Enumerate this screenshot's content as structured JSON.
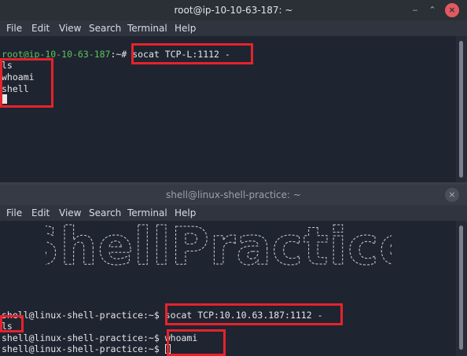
{
  "top_window": {
    "title": "root@ip-10-10-63-187: ~",
    "menu": [
      "File",
      "Edit",
      "View",
      "Search",
      "Terminal",
      "Help"
    ],
    "prompt_user": "root@ip-10-10-63-187",
    "prompt_path": ":~#",
    "command": " socat TCP-L:1112 -",
    "output": [
      "ls",
      "whoami",
      "shell"
    ],
    "controls": {
      "minimize": "‒",
      "maximize": "⌃",
      "close": "×"
    }
  },
  "bottom_window": {
    "title": "shell@linux-shell-practice: ~",
    "menu": [
      "File",
      "Edit",
      "View",
      "Search",
      "Terminal",
      "Help"
    ],
    "banner_text": "ShellPractice",
    "prompt": "shell@linux-shell-practice:~$",
    "lines": [
      {
        "prompt": "shell@linux-shell-practice:~$",
        "command": " socat TCP:10.10.63.187:1112 -"
      },
      {
        "prompt": "",
        "command": "ls"
      },
      {
        "prompt": "shell@linux-shell-practice:~$",
        "command": " whoami"
      },
      {
        "prompt": "shell@linux-shell-practice:~$",
        "command": " "
      }
    ],
    "controls": {
      "close": "×"
    }
  },
  "colors": {
    "titlebar_bg": "#2b2f36",
    "terminal_bg": "#1f2431",
    "prompt_green": "#5ec25b",
    "highlight_red": "#e6222c",
    "close_button": "#e45960"
  }
}
